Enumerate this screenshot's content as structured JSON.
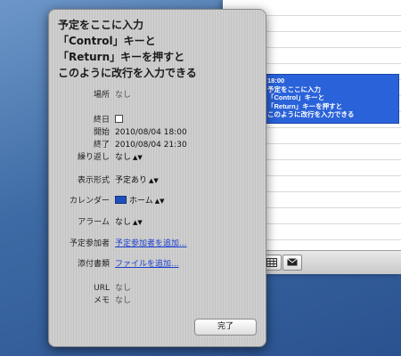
{
  "popover": {
    "title_lines": [
      "予定をここに入力",
      "「Control」キーと",
      "「Return」キーを押すと",
      "このように改行を入力できる"
    ],
    "location": {
      "label": "場所",
      "value": "なし"
    },
    "allday": {
      "label": "終日"
    },
    "start": {
      "label": "開始",
      "value": "2010/08/04 18:00"
    },
    "end": {
      "label": "終了",
      "value": "2010/08/04 21:30"
    },
    "repeat": {
      "label": "繰り返し",
      "value": "なし"
    },
    "show_as": {
      "label": "表示形式",
      "value": "予定あり"
    },
    "calendar": {
      "label": "カレンダー",
      "value": "ホーム",
      "color": "#1e4fbf"
    },
    "alarm": {
      "label": "アラーム",
      "value": "なし"
    },
    "attendees": {
      "label": "予定参加者",
      "link": "予定参加者を追加..."
    },
    "attachments": {
      "label": "添付書類",
      "link": "ファイルを追加..."
    },
    "url": {
      "label": "URL",
      "value": "なし"
    },
    "memo": {
      "label": "メモ",
      "value": "なし"
    },
    "done_label": "完了"
  },
  "calendar_event": {
    "time": "18:00",
    "lines": [
      "予定をここに入力",
      "「Control」キーと",
      "「Return」キーを押すと",
      "このように改行を入力できる"
    ],
    "color": "#2a62d9"
  },
  "toolbar": {
    "icons": [
      "grid-icon",
      "mail-icon"
    ]
  }
}
